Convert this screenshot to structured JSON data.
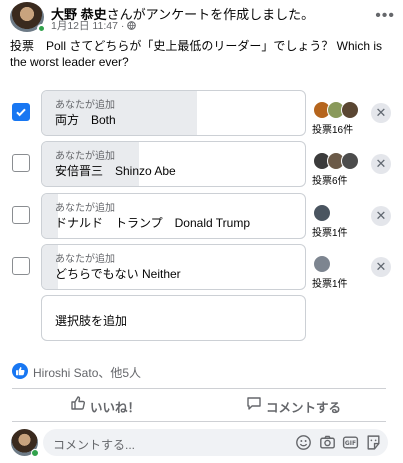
{
  "post": {
    "author": "大野 恭史",
    "author_suffix": "さんがアンケートを作成しました。",
    "date": "1月12日 11:47 · ",
    "question": "投票　Poll さてどちらが「史上最低のリーダー」でしょう？ Which is the worst leader ever?"
  },
  "poll": {
    "added_by_label": "あなたが追加",
    "options": [
      {
        "label": "両方　Both",
        "votes_text": "投票16件",
        "checked": true,
        "share": 0.59
      },
      {
        "label": "安倍晋三　Shinzo Abe",
        "votes_text": "投票6件",
        "checked": false,
        "share": 0.37
      },
      {
        "label": "ドナルド　トランプ　Donald Trump",
        "votes_text": "投票1件",
        "checked": false,
        "share": 0.06
      },
      {
        "label": "どちらでもない Neither",
        "votes_text": "投票1件",
        "checked": false,
        "share": 0.06
      }
    ],
    "add_choice_label": "選択肢を追加"
  },
  "reactions": {
    "text": "Hiroshi Sato、他5人"
  },
  "actions": {
    "like": "いいね！",
    "comment": "コメントする"
  },
  "comment_input": {
    "placeholder": "コメントする..."
  },
  "icons": {
    "more": "more-horizontal-icon",
    "audience": "globe-icon",
    "checkmark": "checkmark-icon",
    "remove": "close-icon",
    "like_badge": "thumbs-up-icon",
    "like_action": "thumbs-up-outline-icon",
    "comment_action": "comment-bubble-icon",
    "emoji": "emoji-icon",
    "camera": "camera-icon",
    "gif": "gif-icon",
    "sticker": "sticker-icon"
  },
  "colors": {
    "accent": "#1877f2",
    "online": "#31a24c"
  }
}
